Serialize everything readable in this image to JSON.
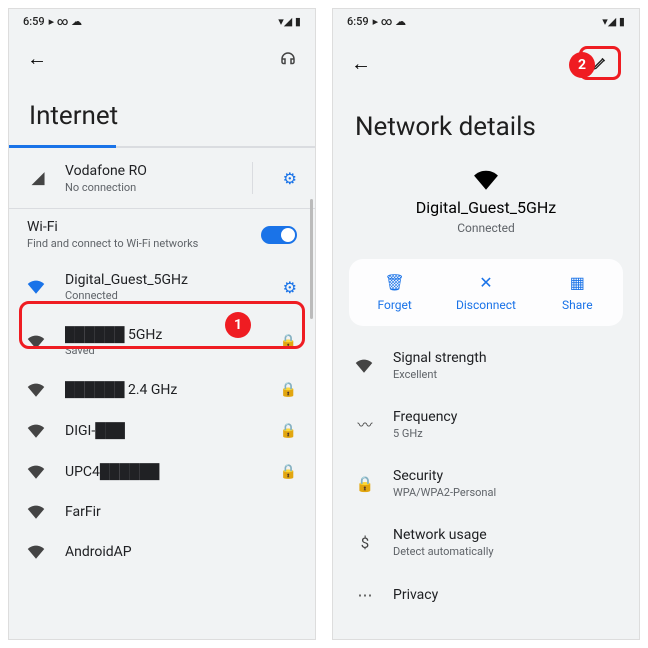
{
  "status": {
    "time": "6:59",
    "icons": "▸ ∞ ☁",
    "right": "▾◢ ▮"
  },
  "left": {
    "title": "Internet",
    "carrier": {
      "name": "Vodafone RO",
      "status": "No connection"
    },
    "wifi": {
      "title": "Wi-Fi",
      "sub": "Find and connect to Wi-Fi networks"
    },
    "networks": [
      {
        "name": "Digital_Guest_5GHz",
        "status": "Connected",
        "gear": true,
        "connected": true
      },
      {
        "name": "██████ 5GHz",
        "status": "Saved",
        "lock": true
      },
      {
        "name": "██████ 2.4 GHz",
        "lock": true
      },
      {
        "name": "DIGI-███",
        "lock": true
      },
      {
        "name": "UPC4██████",
        "lock": true
      },
      {
        "name": "FarFir"
      },
      {
        "name": "AndroidAP"
      }
    ],
    "badge": "1"
  },
  "right": {
    "title": "Network details",
    "network": {
      "name": "Digital_Guest_5GHz",
      "status": "Connected"
    },
    "actions": {
      "forget": "Forget",
      "disconnect": "Disconnect",
      "share": "Share"
    },
    "details": [
      {
        "icon": "wifi",
        "label": "Signal strength",
        "value": "Excellent"
      },
      {
        "icon": "freq",
        "label": "Frequency",
        "value": "5 GHz"
      },
      {
        "icon": "lock",
        "label": "Security",
        "value": "WPA/WPA2-Personal"
      },
      {
        "icon": "dollar",
        "label": "Network usage",
        "value": "Detect automatically"
      },
      {
        "icon": "priv",
        "label": "Privacy",
        "value": ""
      }
    ],
    "badge": "2"
  }
}
